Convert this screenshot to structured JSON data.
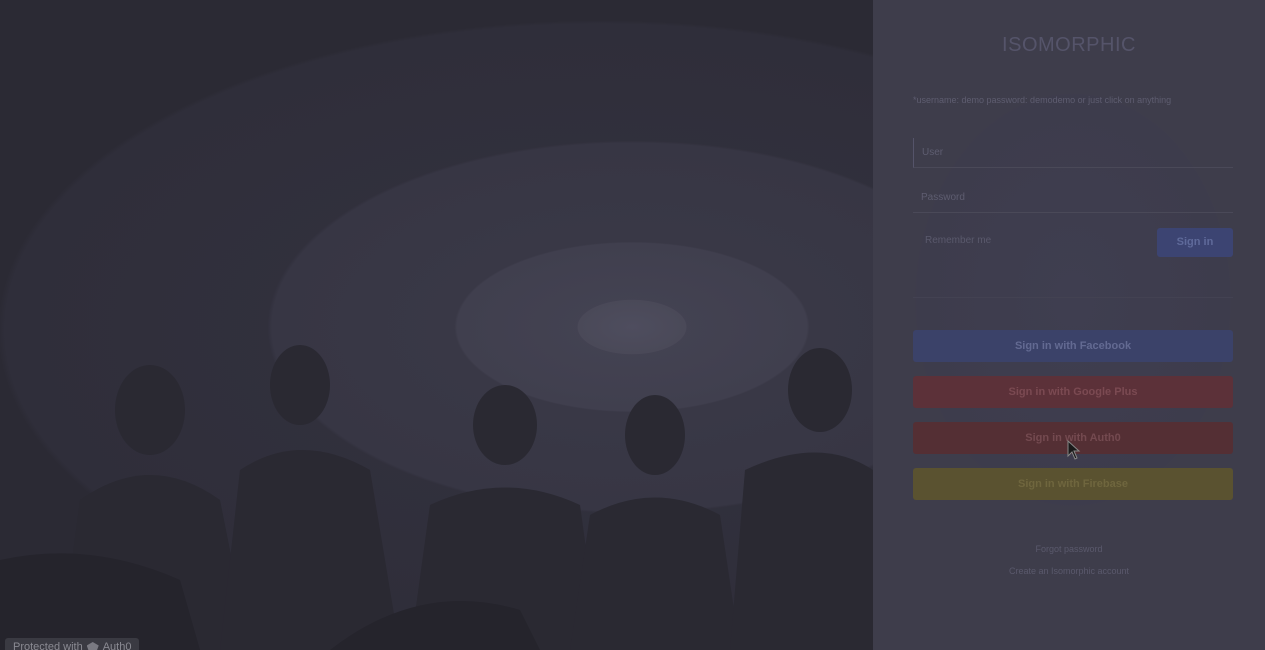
{
  "left": {
    "badge_text": "Protected with",
    "badge_brand": "Auth0"
  },
  "login": {
    "logo": "ISOMORPHIC",
    "hint": "*username: demo password: demodemo or just click on anything",
    "username_placeholder": "User",
    "password_placeholder": "Password",
    "remember_label": "Remember me",
    "signin_label": "Sign in",
    "social": {
      "facebook": "Sign in with Facebook",
      "google": "Sign in with Google Plus",
      "auth0": "Sign in with Auth0",
      "firebase": "Sign in with Firebase"
    },
    "forgot": "Forgot password",
    "create": "Create an Isomorphic account"
  },
  "colors": {
    "facebook": "#3b4269",
    "google": "#5c3139",
    "auth0": "#542f34",
    "firebase": "#5a5230",
    "signin": "#3c4472"
  }
}
